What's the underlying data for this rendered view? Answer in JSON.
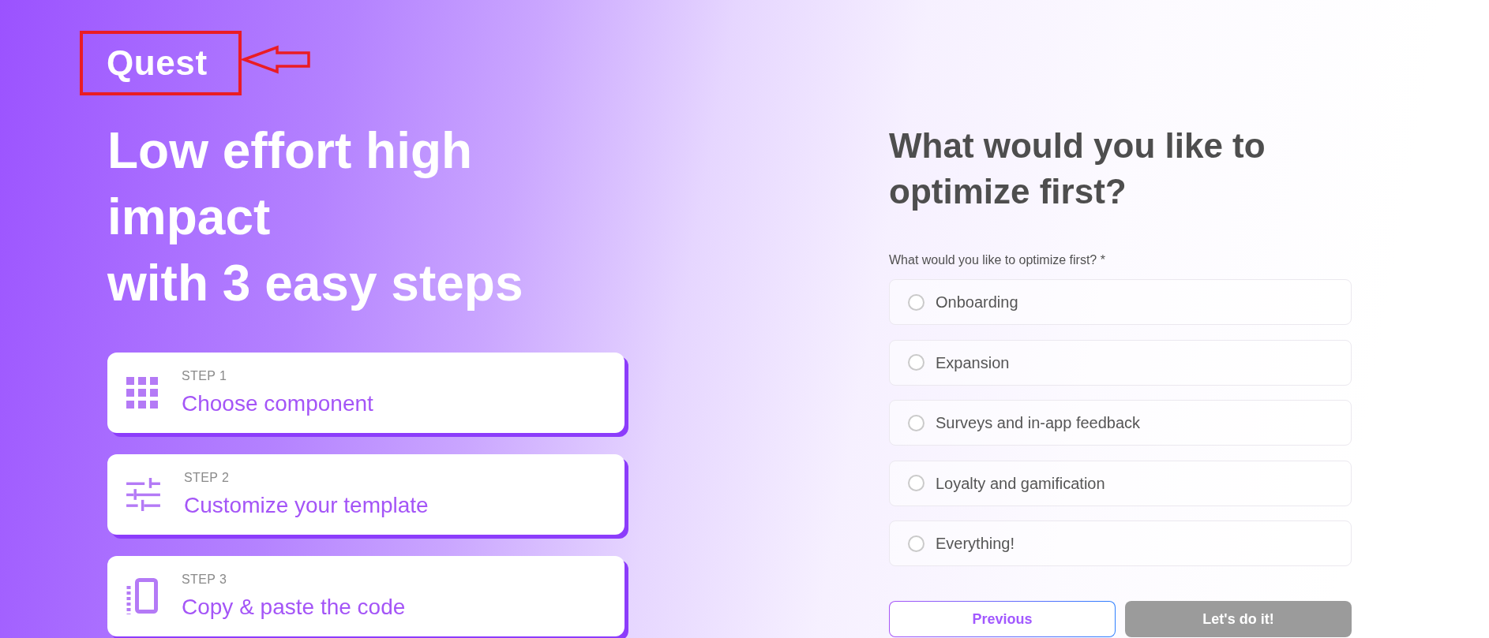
{
  "logo": {
    "text": "Quest",
    "highlighted": true
  },
  "headline": {
    "lines": [
      "Low effort high impact",
      "with 3 easy steps"
    ]
  },
  "steps": [
    {
      "label": "STEP 1",
      "title": "Choose component"
    },
    {
      "label": "STEP 2",
      "title": "Customize your template"
    },
    {
      "label": "STEP 3",
      "title": "Copy & paste the code"
    }
  ],
  "question": {
    "title": "What would you like to optimize first?",
    "label": "What would you like to optimize first? *",
    "options": [
      {
        "label": "Onboarding",
        "selected": false
      },
      {
        "label": "Expansion",
        "selected": false
      },
      {
        "label": "Surveys and in-app feedback",
        "selected": false
      },
      {
        "label": "Loyalty and gamification",
        "selected": false
      },
      {
        "label": "Everything!",
        "selected": false
      }
    ]
  },
  "buttons": [
    {
      "label": "Previous",
      "kind": "outline",
      "disabled": false
    },
    {
      "label": "Let's do it!",
      "kind": "filled",
      "disabled": true
    }
  ]
}
